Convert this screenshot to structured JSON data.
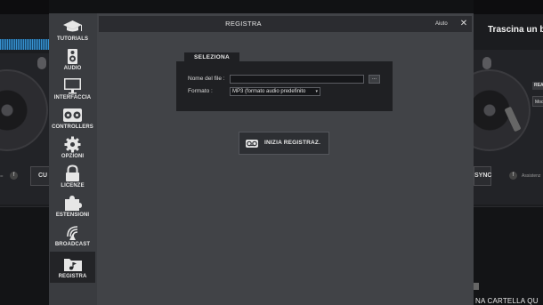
{
  "background": {
    "right_title": "Trascina un b",
    "cue_label": "CU",
    "sync_label": "SYNC",
    "left_f": "f",
    "right_f": "f",
    "left_dots": "=",
    "assist_label": "Assistenz",
    "side_btn_1": "REA",
    "side_btn_2": "Mod",
    "drop_label": "NA CARTELLA QU"
  },
  "modal": {
    "title": "REGISTRA",
    "help_label": "Aiuto",
    "close_glyph": "✕"
  },
  "sidebar": {
    "items": [
      {
        "id": "tutorials",
        "label": "TUTORIALS",
        "icon": "graduation-cap-icon"
      },
      {
        "id": "audio",
        "label": "AUDIO",
        "icon": "speaker-icon"
      },
      {
        "id": "interfaccia",
        "label": "INTERFACCIA",
        "icon": "monitor-icon"
      },
      {
        "id": "controllers",
        "label": "CONTROLLERS",
        "icon": "controller-icon"
      },
      {
        "id": "opzioni",
        "label": "OPZIONI",
        "icon": "gear-icon"
      },
      {
        "id": "licenze",
        "label": "LICENZE",
        "icon": "lock-icon"
      },
      {
        "id": "estensioni",
        "label": "ESTENSIONI",
        "icon": "puzzle-icon"
      },
      {
        "id": "broadcast",
        "label": "BROADCAST",
        "icon": "broadcast-icon"
      },
      {
        "id": "registra",
        "label": "REGISTRA",
        "icon": "music-folder-icon",
        "active": true
      }
    ]
  },
  "record": {
    "tab_label": "SELEZIONA",
    "filename_label": "Nome del file :",
    "filename_value": "",
    "browse_label": "...",
    "format_label": "Formato :",
    "format_value": "MP3 (formato audio predefinito",
    "format_chevron": "▾",
    "start_label": "INIZIA REGISTRAZ."
  },
  "colors": {
    "modal_bg": "#414347",
    "sidebar_bg": "#3a3c40",
    "panel_bg": "#1f2023",
    "header_bg": "#2b2c30",
    "text": "#e8e8e8"
  }
}
